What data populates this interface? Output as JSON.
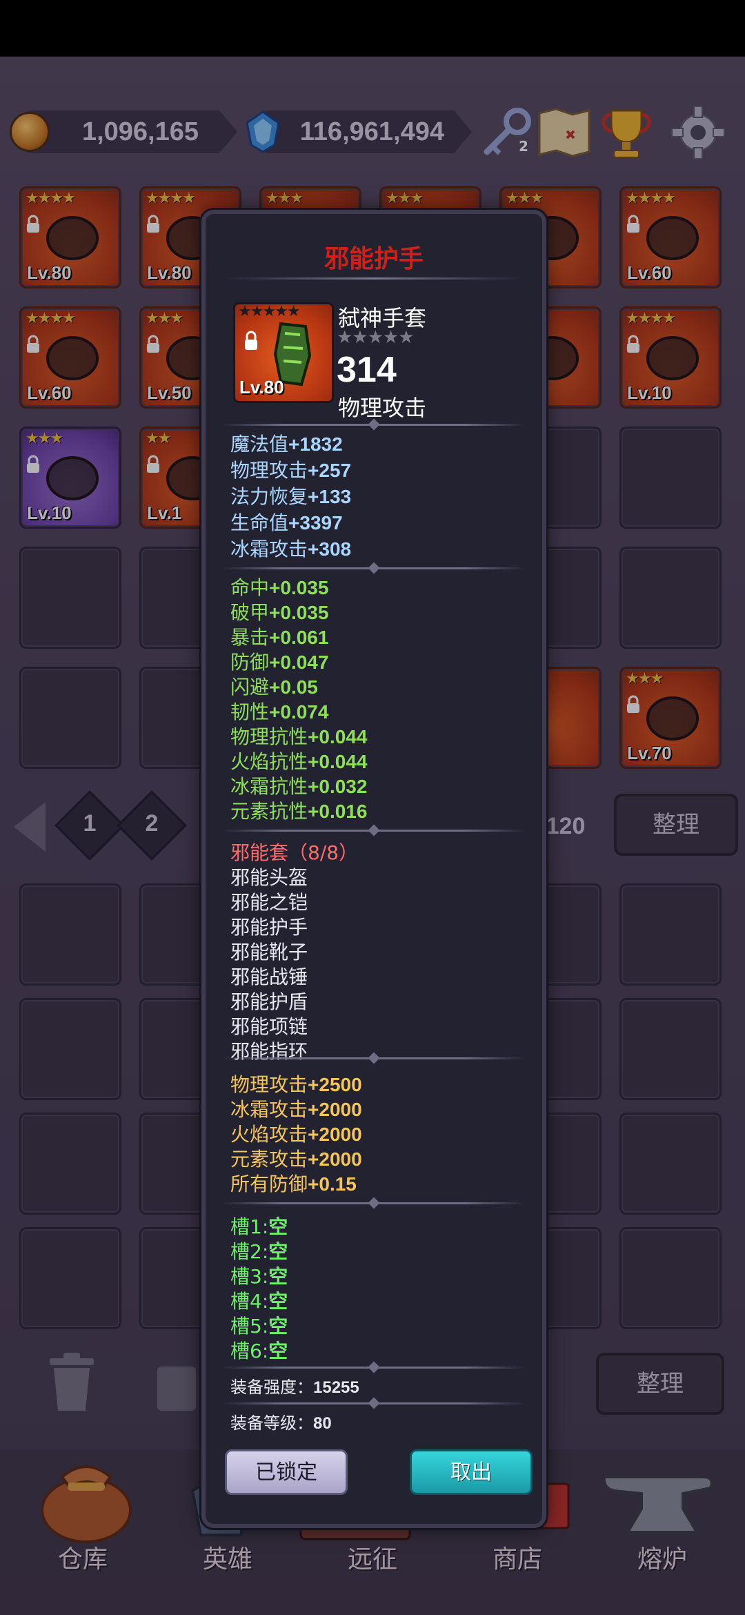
{
  "currency": {
    "gold": "1,096,165",
    "gems": "116,961,494",
    "key_count": "2"
  },
  "icons": {
    "coin": "coin-stack-icon",
    "gem": "blue-gem-icon",
    "key": "key-icon",
    "map": "treasure-map-icon",
    "trophy": "trophy-icon",
    "settings": "gear-icon"
  },
  "inventory_upper": [
    {
      "lv": "Lv.80",
      "stars": "★★★★",
      "color": "red"
    },
    {
      "lv": "Lv.80",
      "stars": "★★★★",
      "color": "red"
    },
    {
      "lv": "",
      "stars": "★★★",
      "color": "red"
    },
    {
      "lv": "",
      "stars": "★★★",
      "color": "red"
    },
    {
      "lv": "",
      "stars": "★★★",
      "color": "red"
    },
    {
      "lv": "Lv.60",
      "stars": "★★★★",
      "color": "red"
    },
    {
      "lv": "Lv.60",
      "stars": "★★★★",
      "color": "red"
    },
    {
      "lv": "Lv.50",
      "stars": "★★★",
      "color": "red"
    },
    {
      "lv": "",
      "stars": "",
      "color": "red"
    },
    {
      "lv": "",
      "stars": "",
      "color": "red"
    },
    {
      "lv": "",
      "stars": "",
      "color": "red"
    },
    {
      "lv": "Lv.10",
      "stars": "★★★★",
      "color": "red"
    },
    {
      "lv": "Lv.10",
      "stars": "★★★",
      "color": "purple"
    },
    {
      "lv": "Lv.1",
      "stars": "★★",
      "color": "red"
    },
    {
      "lv": "Lv.70",
      "stars": "★★★",
      "color": "red"
    }
  ],
  "pagination": {
    "pages": [
      "1",
      "2"
    ],
    "last_page": "120",
    "tidy_label": "整理"
  },
  "tidy_label_lower": "整理",
  "bottom_nav": [
    "仓库",
    "英雄",
    "远征",
    "商店",
    "熔炉"
  ],
  "popup": {
    "title": "邪能护手",
    "item": {
      "name": "弑神手套",
      "stars": "★★★★★",
      "lv": "Lv.80",
      "power": "314",
      "type": "物理攻击"
    },
    "base_stats": [
      {
        "label": "魔法值",
        "value": "+1832"
      },
      {
        "label": "物理攻击",
        "value": "+257"
      },
      {
        "label": "法力恢复",
        "value": "+133"
      },
      {
        "label": "生命值",
        "value": "+3397"
      },
      {
        "label": "冰霜攻击",
        "value": "+308"
      }
    ],
    "extra_stats": [
      {
        "label": "命中",
        "value": "+0.035"
      },
      {
        "label": "破甲",
        "value": "+0.035"
      },
      {
        "label": "暴击",
        "value": "+0.061"
      },
      {
        "label": "防御",
        "value": "+0.047"
      },
      {
        "label": "闪避",
        "value": "+0.05"
      },
      {
        "label": "韧性",
        "value": "+0.074"
      },
      {
        "label": "物理抗性",
        "value": "+0.044"
      },
      {
        "label": "火焰抗性",
        "value": "+0.044"
      },
      {
        "label": "冰霜抗性",
        "value": "+0.032"
      },
      {
        "label": "元素抗性",
        "value": "+0.016"
      }
    ],
    "set_title": "邪能套（8/8）",
    "set_items": [
      "邪能头盔",
      "邪能之铠",
      "邪能护手",
      "邪能靴子",
      "邪能战锤",
      "邪能护盾",
      "邪能项链",
      "邪能指环"
    ],
    "set_bonus": [
      {
        "label": "物理攻击",
        "value": "+2500"
      },
      {
        "label": "冰霜攻击",
        "value": "+2000"
      },
      {
        "label": "火焰攻击",
        "value": "+2000"
      },
      {
        "label": "元素攻击",
        "value": "+2000"
      },
      {
        "label": "所有防御",
        "value": "+0.15"
      }
    ],
    "sockets": [
      {
        "label": "槽1:",
        "value": "空"
      },
      {
        "label": "槽2:",
        "value": "空"
      },
      {
        "label": "槽3:",
        "value": "空"
      },
      {
        "label": "槽4:",
        "value": "空"
      },
      {
        "label": "槽5:",
        "value": "空"
      },
      {
        "label": "槽6:",
        "value": "空"
      }
    ],
    "strength_label": "装备强度：",
    "strength_value": "15255",
    "level_label": "装备等级：",
    "level_value": "80",
    "locked_button": "已锁定",
    "take_button": "取出"
  }
}
